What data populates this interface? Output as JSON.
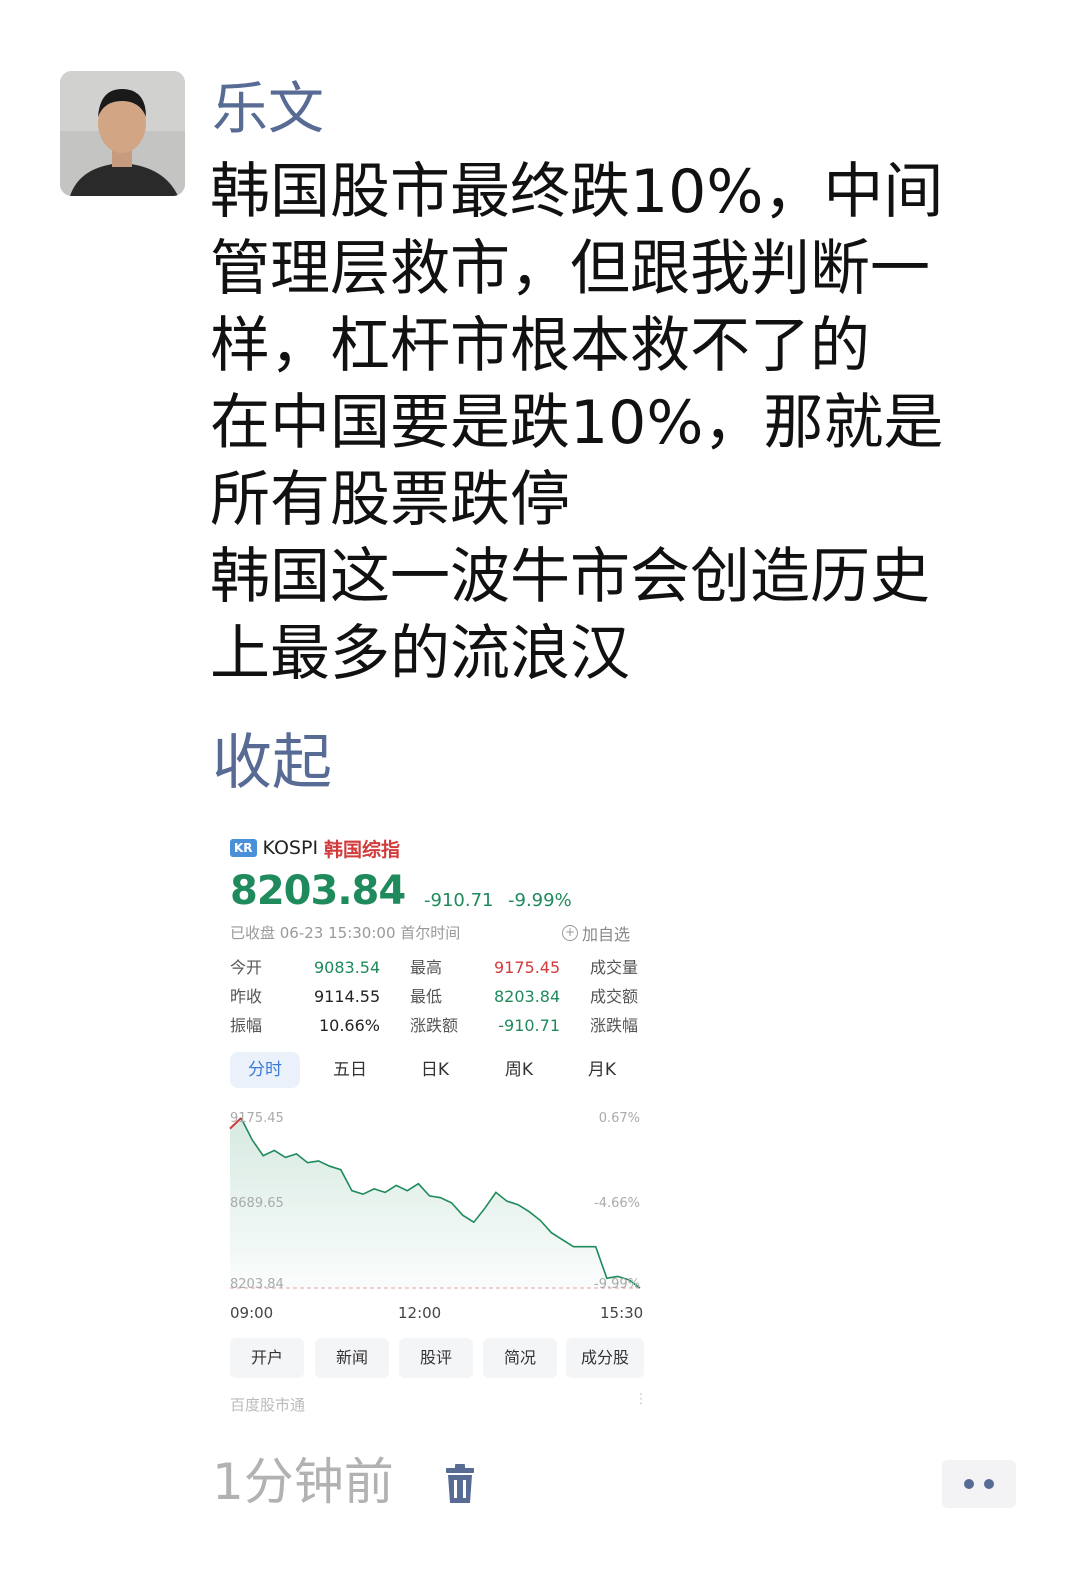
{
  "post": {
    "author": "乐文",
    "lines": [
      "韩国股市最终跌10%，中间",
      "管理层救市，但跟我判断一",
      "样，杠杆市根本救不了的",
      "在中国要是跌10%，那就是",
      "所有股票跌停",
      "韩国这一波牛市会创造历史",
      "上最多的流浪汉"
    ],
    "collapse_label": "收起",
    "time_ago": "1分钟前"
  },
  "card": {
    "badge": "KR",
    "symbol": "KOSPI",
    "name": "韩国综指",
    "price": "8203.84",
    "change": "-910.71",
    "change_pct": "-9.99%",
    "status": "已收盘 06-23 15:30:00 首尔时间",
    "add_watch": "加自选",
    "stats": {
      "open_label": "今开",
      "open": "9083.54",
      "high_label": "最高",
      "high": "9175.45",
      "volume_label": "成交量",
      "prev_label": "昨收",
      "prev": "9114.55",
      "low_label": "最低",
      "low": "8203.84",
      "turnover_label": "成交额",
      "amp_label": "振幅",
      "amp": "10.66%",
      "chg_label": "涨跌额",
      "chg": "-910.71",
      "chgpct_label": "涨跌幅"
    },
    "tabs": [
      "分时",
      "五日",
      "日K",
      "周K",
      "月K"
    ],
    "active_tab": 0,
    "buttons": [
      "开户",
      "新闻",
      "股评",
      "简况",
      "成分股"
    ],
    "source": "百度股市通",
    "colors": {
      "up": "#d23b3b",
      "down": "#1f8a5b",
      "accent": "#3a7bd5",
      "link": "#576b95"
    }
  },
  "chart_data": {
    "type": "line",
    "x": [
      "09:00",
      "12:00",
      "15:30"
    ],
    "ylim": [
      8203.84,
      9175.45
    ],
    "y_left_ticks": [
      "9175.45",
      "8689.65",
      "8203.84"
    ],
    "y_right_ticks": [
      "0.67%",
      "-4.66%",
      "-9.99%"
    ],
    "reference_line": 9114.55,
    "series": [
      {
        "values": [
          9114.55,
          9175.45,
          9050,
          8960,
          8990,
          8950,
          8970,
          8920,
          8930,
          8900,
          8880,
          8760,
          8740,
          8770,
          8750,
          8790,
          8760,
          8800,
          8730,
          8720,
          8690,
          8620,
          8580,
          8660,
          8750,
          8700,
          8680,
          8640,
          8590,
          8520,
          8480,
          8440,
          8440,
          8440,
          8260,
          8270,
          8250,
          8203.84
        ]
      }
    ]
  }
}
